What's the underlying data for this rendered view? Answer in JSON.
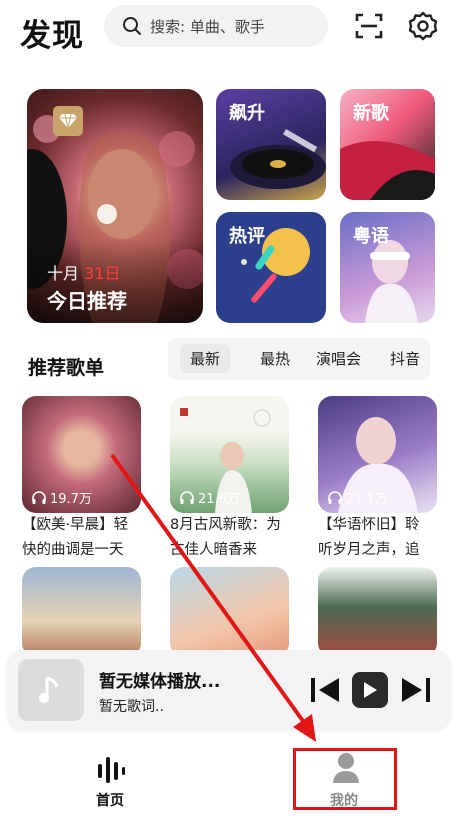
{
  "header": {
    "logo": "发现",
    "search_placeholder": "搜索: 单曲、歌手",
    "scan_icon": "scan-icon",
    "settings_icon": "settings-icon"
  },
  "featured": {
    "date_month": "十月",
    "date_day": "31日",
    "title": "今日推荐",
    "badge_icon": "diamond-icon"
  },
  "tiles": [
    {
      "label": "飙升"
    },
    {
      "label": "新歌"
    },
    {
      "label": "热评"
    },
    {
      "label": "粤语"
    }
  ],
  "section": {
    "title": "推荐歌单",
    "tabs": [
      "最新",
      "最热",
      "演唱会",
      "抖音"
    ],
    "active_tab": "最新"
  },
  "playlists": [
    {
      "count": "19.7万",
      "title_l1": "【欧美·早晨】轻",
      "title_l2": "快的曲调是一天"
    },
    {
      "count": "21.6万",
      "title_l1": "8月古风新歌：为",
      "title_l2": "古佳人暗香来"
    },
    {
      "count": "21.1万",
      "title_l1": "【华语怀旧】聆",
      "title_l2": "听岁月之声，追"
    }
  ],
  "player": {
    "title": "暂无媒体播放...",
    "subtitle": "暂无歌词.."
  },
  "nav": {
    "home": "首页",
    "mine": "我的"
  },
  "colors": {
    "annotation_red": "#e21616",
    "date_red": "#ff3b3b"
  }
}
